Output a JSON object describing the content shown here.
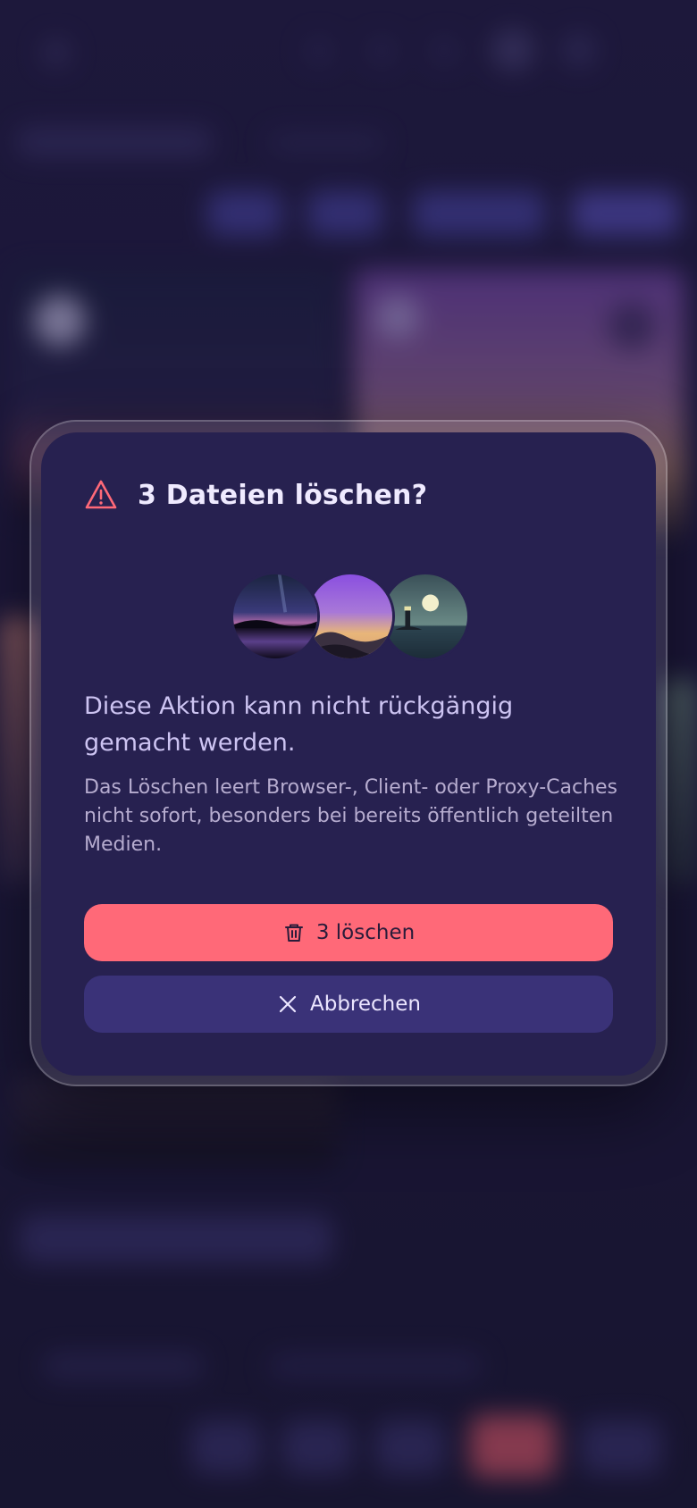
{
  "dialog": {
    "title": "3 Dateien löschen?",
    "message": "Diese Aktion kann nicht rückgängig gemacht werden.",
    "detail": "Das Löschen leert Browser-, Client- oder Proxy-Caches nicht sofort, besonders bei bereits öffentlich geteilten Medien.",
    "confirm_label": "3 löschen",
    "cancel_label": "Abbrechen",
    "thumbnails": [
      "night-lake-thumbnail",
      "sunset-hills-thumbnail",
      "lighthouse-moon-thumbnail"
    ]
  },
  "icons": {
    "title": "warning-triangle-icon",
    "confirm": "trash-icon",
    "cancel": "close-icon"
  },
  "colors": {
    "accent_danger": "#ff6978",
    "dialog_bg": "#272150",
    "cancel_bg": "#3a3278",
    "title_text": "#efeaff"
  }
}
